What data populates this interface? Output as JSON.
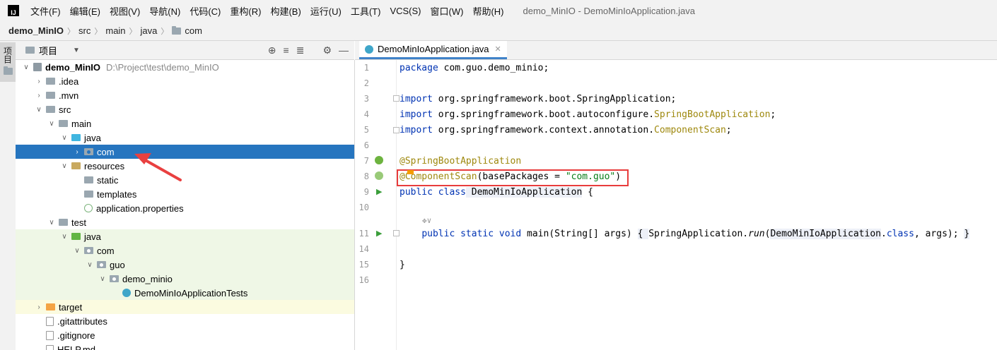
{
  "menubar": {
    "logo": "IJ",
    "items": [
      "文件(F)",
      "编辑(E)",
      "视图(V)",
      "导航(N)",
      "代码(C)",
      "重构(R)",
      "构建(B)",
      "运行(U)",
      "工具(T)",
      "VCS(S)",
      "窗口(W)",
      "帮助(H)"
    ],
    "window_title": "demo_MinIO - DemoMinIoApplication.java"
  },
  "breadcrumb": {
    "project": "demo_MinIO",
    "parts": [
      "src",
      "main",
      "java",
      "com"
    ]
  },
  "side_stripe": {
    "label": "项目"
  },
  "project_panel": {
    "title": "项目",
    "tools": [
      "target-icon",
      "expand-icon",
      "collapse-icon",
      "gear-icon",
      "minimize-icon"
    ],
    "tree": [
      {
        "label": "demo_MinIO",
        "path": "D:\\Project\\test\\demo_MinIO",
        "indent": 0,
        "chev": "v",
        "icon": "module",
        "bold": true
      },
      {
        "label": ".idea",
        "indent": 1,
        "chev": ">",
        "icon": "grey"
      },
      {
        "label": ".mvn",
        "indent": 1,
        "chev": ">",
        "icon": "grey"
      },
      {
        "label": "src",
        "indent": 1,
        "chev": "v",
        "icon": "grey"
      },
      {
        "label": "main",
        "indent": 2,
        "chev": "v",
        "icon": "grey"
      },
      {
        "label": "java",
        "indent": 3,
        "chev": "v",
        "icon": "blue"
      },
      {
        "label": "com",
        "indent": 4,
        "chev": ">",
        "icon": "pkg",
        "selected": true
      },
      {
        "label": "resources",
        "indent": 3,
        "chev": "v",
        "icon": "res"
      },
      {
        "label": "static",
        "indent": 4,
        "chev": "",
        "icon": "grey"
      },
      {
        "label": "templates",
        "indent": 4,
        "chev": "",
        "icon": "grey"
      },
      {
        "label": "application.properties",
        "indent": 4,
        "chev": "",
        "icon": "prop"
      },
      {
        "label": "test",
        "indent": 2,
        "chev": "v",
        "icon": "grey"
      },
      {
        "label": "java",
        "indent": 3,
        "chev": "v",
        "icon": "green",
        "test": true
      },
      {
        "label": "com",
        "indent": 4,
        "chev": "v",
        "icon": "pkg",
        "test": true
      },
      {
        "label": "guo",
        "indent": 5,
        "chev": "v",
        "icon": "pkg",
        "test": true
      },
      {
        "label": "demo_minio",
        "indent": 6,
        "chev": "v",
        "icon": "pkg",
        "test": true
      },
      {
        "label": "DemoMinIoApplicationTests",
        "indent": 7,
        "chev": "",
        "icon": "java",
        "test": true
      },
      {
        "label": "target",
        "indent": 1,
        "chev": ">",
        "icon": "orange",
        "target": true
      },
      {
        "label": ".gitattributes",
        "indent": 1,
        "chev": "",
        "icon": "file"
      },
      {
        "label": ".gitignore",
        "indent": 1,
        "chev": "",
        "icon": "file"
      },
      {
        "label": "HELP.md",
        "indent": 1,
        "chev": "",
        "icon": "file"
      }
    ]
  },
  "editor": {
    "tab_label": "DemoMinIoApplication.java",
    "line_numbers": [
      "1",
      "2",
      "3",
      "4",
      "5",
      "6",
      "7",
      "8",
      "9",
      "10",
      "11",
      "14",
      "15",
      "16"
    ],
    "code": {
      "l1_kw": "package",
      "l1_rest": " com.guo.demo_minio;",
      "l3_kw": "import",
      "l3_rest": " org.springframework.boot.SpringApplication;",
      "l4_kw": "import",
      "l4_rest": " org.springframework.boot.autoconfigure.",
      "l4_ann": "SpringBootApplication",
      "l4_end": ";",
      "l5_kw": "import",
      "l5_rest": " org.springframework.context.annotation.",
      "l5_ann": "ComponentScan",
      "l5_end": ";",
      "l7_ann": "@SpringBootApplication",
      "l8_ann": "@ComponentScan",
      "l8_mid": "(basePackages = ",
      "l8_str": "\"com.guo\"",
      "l8_end": ")",
      "l9_kw": "public class",
      "l9_cls": " DemoMinIoApplication",
      "l9_end": " {",
      "l10_hint": "✥∨",
      "l11_kw": "public static void",
      "l11_a": " main(String[] args) ",
      "l11_b": "{ ",
      "l11_c": "SpringApplication.",
      "l11_run": "run",
      "l11_d": "(",
      "l11_e": "DemoMinIoApplication",
      "l11_f": ".",
      "l11_class": "class",
      "l11_g": ", args); ",
      "l11_h": "}",
      "l15": "}"
    }
  }
}
